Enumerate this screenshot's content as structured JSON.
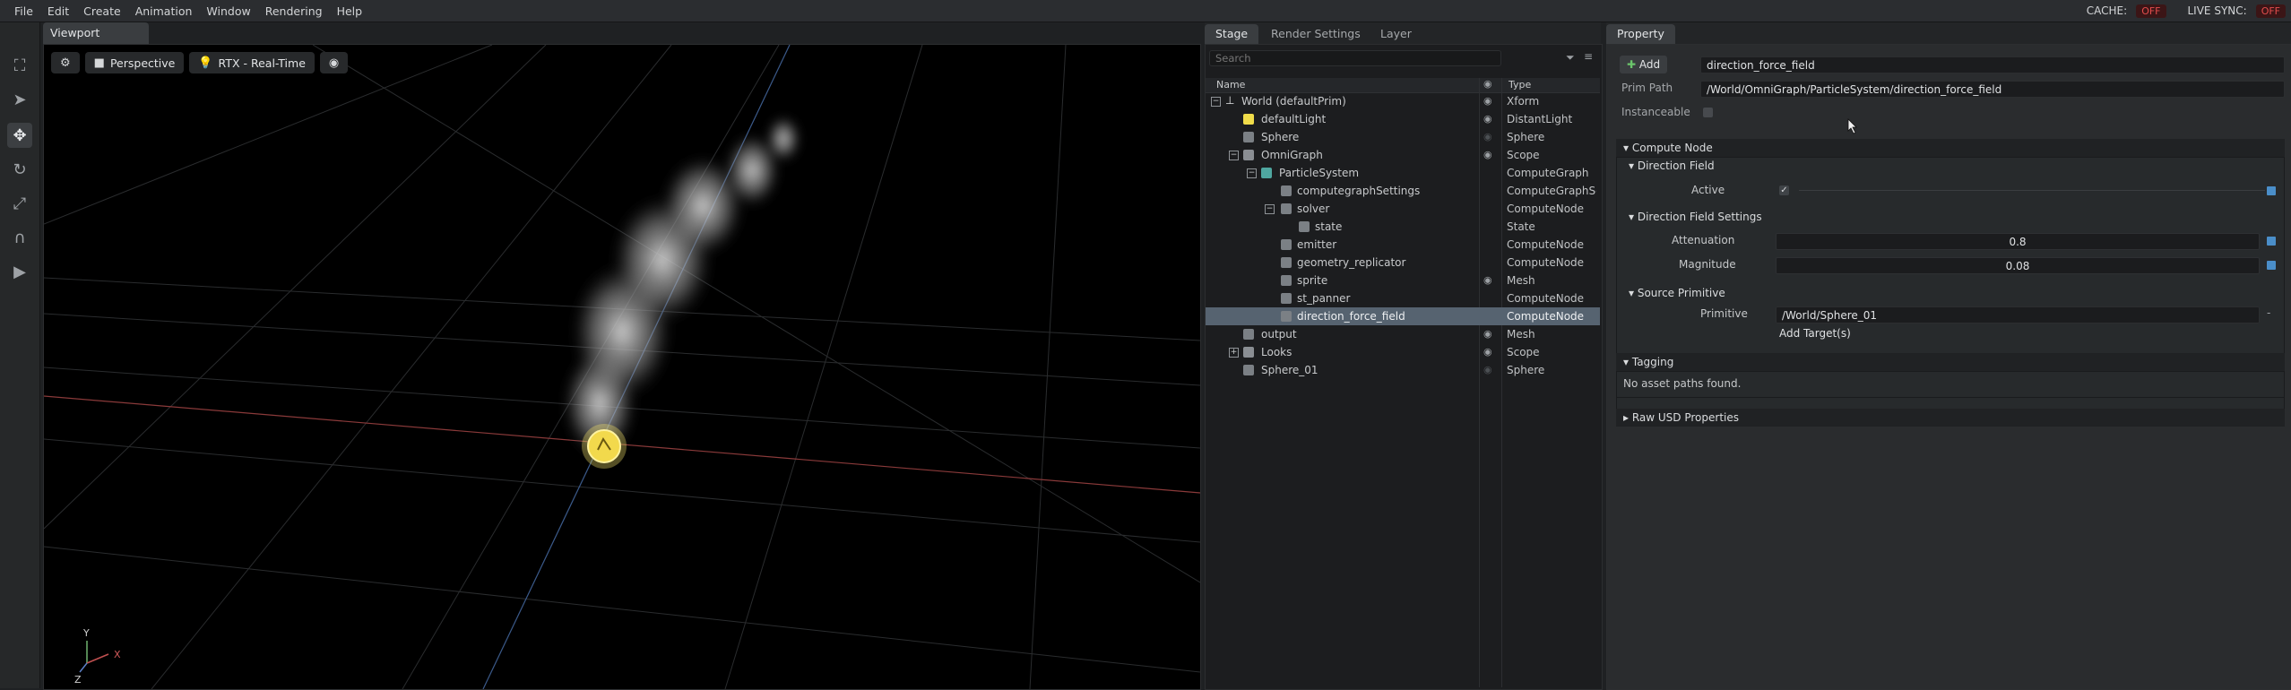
{
  "menubar": {
    "items": [
      "File",
      "Edit",
      "Create",
      "Animation",
      "Window",
      "Rendering",
      "Help"
    ],
    "cache_label": "CACHE:",
    "cache_state": "OFF",
    "live_sync_label": "LIVE SYNC:",
    "live_sync_state": "OFF"
  },
  "viewport": {
    "tab": "Viewport",
    "camera": "Perspective",
    "renderer": "RTX - Real-Time",
    "axes": {
      "y": "Y",
      "x": "X",
      "z": "Z"
    }
  },
  "stage": {
    "tabs": [
      "Stage",
      "Render Settings",
      "Layer"
    ],
    "search_placeholder": "Search",
    "col_name": "Name",
    "col_type": "Type",
    "rows": [
      {
        "name": "World (defaultPrim)",
        "type": "Xform",
        "icon": "xform-icon"
      },
      {
        "name": "defaultLight",
        "type": "DistantLight",
        "icon": "light-icon"
      },
      {
        "name": "Sphere",
        "type": "Sphere",
        "icon": "cube-icon"
      },
      {
        "name": "OmniGraph",
        "type": "Scope",
        "icon": "folder-icon"
      },
      {
        "name": "ParticleSystem",
        "type": "ComputeGraph",
        "icon": "graph-icon"
      },
      {
        "name": "computegraphSettings",
        "type": "ComputeGraphSe",
        "icon": "cube-icon"
      },
      {
        "name": "solver",
        "type": "ComputeNode",
        "icon": "cube-icon"
      },
      {
        "name": "state",
        "type": "State",
        "icon": "cube-icon"
      },
      {
        "name": "emitter",
        "type": "ComputeNode",
        "icon": "cube-icon"
      },
      {
        "name": "geometry_replicator",
        "type": "ComputeNode",
        "icon": "cube-icon"
      },
      {
        "name": "sprite",
        "type": "Mesh",
        "icon": "cube-icon"
      },
      {
        "name": "st_panner",
        "type": "ComputeNode",
        "icon": "cube-icon"
      },
      {
        "name": "direction_force_field",
        "type": "ComputeNode",
        "icon": "cube-icon"
      },
      {
        "name": "output",
        "type": "Mesh",
        "icon": "cube-icon"
      },
      {
        "name": "Looks",
        "type": "Scope",
        "icon": "folder-icon"
      },
      {
        "name": "Sphere_01",
        "type": "Sphere",
        "icon": "cube-icon"
      }
    ]
  },
  "property": {
    "tab": "Property",
    "add_label": "Add",
    "prim_name": "direction_force_field",
    "prim_path_label": "Prim Path",
    "prim_path": "/World/OmniGraph/ParticleSystem/direction_force_field",
    "instanceable_label": "Instanceable",
    "compute_node": "Compute Node",
    "direction_field": "Direction Field",
    "active_label": "Active",
    "direction_field_settings": "Direction Field Settings",
    "attenuation_label": "Attenuation",
    "attenuation_value": "0.8",
    "magnitude_label": "Magnitude",
    "magnitude_value": "0.08",
    "source_primitive": "Source Primitive",
    "primitive_label": "Primitive",
    "primitive_value": "/World/Sphere_01",
    "add_targets": "Add Target(s)",
    "tagging": "Tagging",
    "no_asset_paths": "No asset paths found.",
    "raw_usd": "Raw USD Properties"
  }
}
